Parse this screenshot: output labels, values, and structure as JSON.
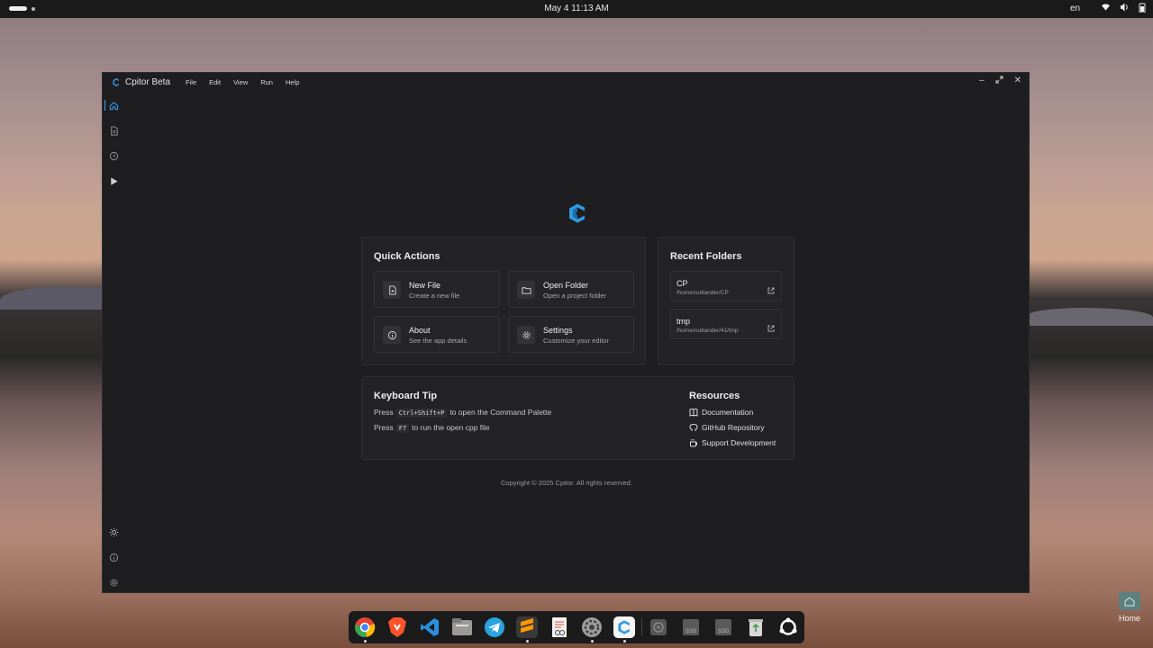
{
  "topbar": {
    "datetime": "May 4  11:13 AM",
    "language": "en"
  },
  "window": {
    "app_title": "Cpitor Beta",
    "menu": [
      "File",
      "Edit",
      "View",
      "Run",
      "Help"
    ]
  },
  "sidebar": {
    "items": [
      "home-icon",
      "file-icon",
      "history-icon",
      "run-icon"
    ],
    "bottom": [
      "theme-icon",
      "info-icon",
      "settings-icon"
    ]
  },
  "quick_actions": {
    "title": "Quick Actions",
    "items": [
      {
        "title": "New File",
        "subtitle": "Create a new file",
        "icon": "new-file-icon"
      },
      {
        "title": "Open Folder",
        "subtitle": "Open a project folder",
        "icon": "folder-icon"
      },
      {
        "title": "About",
        "subtitle": "See the app details",
        "icon": "info-icon"
      },
      {
        "title": "Settings",
        "subtitle": "Customize your editor",
        "icon": "gear-icon"
      }
    ]
  },
  "recent_folders": {
    "title": "Recent Folders",
    "items": [
      {
        "name": "CP",
        "path": "/home/outlander/CP"
      },
      {
        "name": "tmp",
        "path": "/home/outlander/41/tmp"
      }
    ]
  },
  "keyboard_tip": {
    "title": "Keyboard Tip",
    "line1_pre": "Press",
    "line1_key": "Ctrl+Shift+P",
    "line1_post": "to open the Command Palette",
    "line2_pre": "Press",
    "line2_key": "F7",
    "line2_post": "to run the open cpp file"
  },
  "resources": {
    "title": "Resources",
    "links": [
      "Documentation",
      "GitHub Repository",
      "Support Development"
    ]
  },
  "footer": {
    "copyright": "Copyright © 2025 Cpitor. All rights reserved."
  },
  "dock": {
    "apps": [
      "chrome",
      "brave",
      "vscode",
      "files",
      "telegram",
      "sublime-text",
      "document-viewer",
      "settings",
      "cpitor",
      "disk",
      "ssd-drive-1",
      "ssd-drive-2",
      "trash",
      "app-grid"
    ],
    "ssd_label": "SSD"
  },
  "desktop": {
    "home_label": "Home"
  },
  "colors": {
    "accent": "#2f9ae0",
    "window_bg": "#1e1e20",
    "card_bg": "#232325"
  }
}
